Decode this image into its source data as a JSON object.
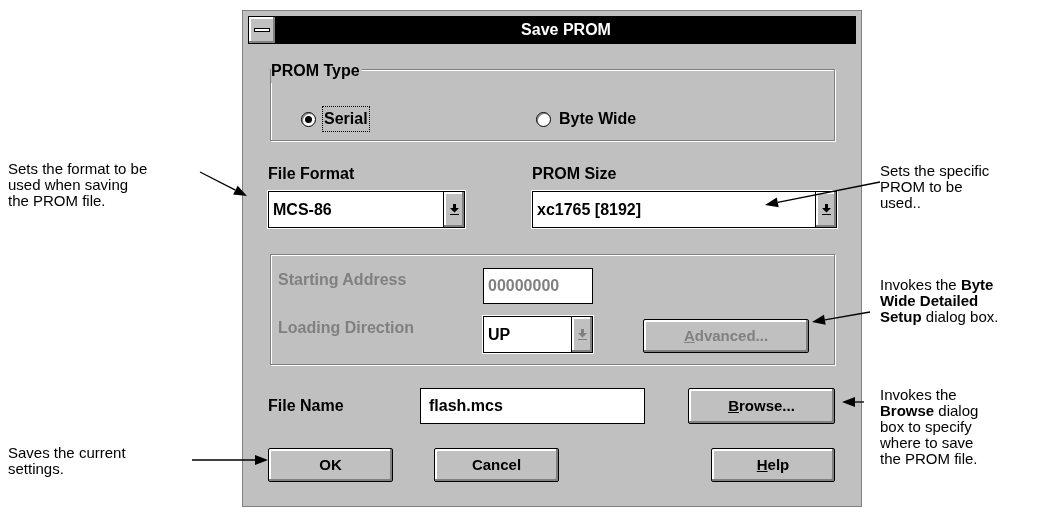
{
  "annotations_left": [
    {
      "lines": [
        "Sets the format to be",
        "used when saving",
        "the PROM file."
      ]
    },
    {
      "lines": [
        "Saves the current",
        "settings."
      ]
    }
  ],
  "dialog": {
    "title": "Save PROM",
    "prom_type": {
      "label": "PROM Type",
      "options": [
        {
          "label": "Serial",
          "selected": true,
          "focused": true
        },
        {
          "label": "Byte Wide",
          "selected": false,
          "focused": false
        }
      ]
    },
    "file_format": {
      "label": "File Format",
      "value": "MCS-86"
    },
    "prom_size": {
      "label": "PROM Size",
      "value": "xc1765 [8192]"
    },
    "byte_wide": {
      "disabled": true,
      "starting_address": {
        "label": "Starting Address",
        "value": "00000000"
      },
      "loading_direction": {
        "label": "Loading Direction",
        "value": "UP"
      },
      "advanced_button": {
        "accel": "A",
        "rest": "dvanced..."
      }
    },
    "file_name": {
      "label": "File Name",
      "value": "flash.mcs"
    },
    "browse_button": {
      "accel": "B",
      "rest": "rowse..."
    },
    "ok_button": {
      "rest": "OK"
    },
    "cancel_button": {
      "rest": "Cancel"
    },
    "help_button": {
      "accel": "H",
      "rest": "elp"
    }
  },
  "annotations_right": [
    {
      "lines": [
        "Sets the specific",
        "PROM to be",
        "used.."
      ]
    },
    {
      "lines": [
        "Invokes the **Byte**",
        "**Wide Detailed**",
        "**Setup** dialog box."
      ]
    },
    {
      "lines": [
        "Invokes the",
        "**Browse** dialog",
        "box to specify",
        "where to save",
        "the PROM file."
      ]
    }
  ]
}
